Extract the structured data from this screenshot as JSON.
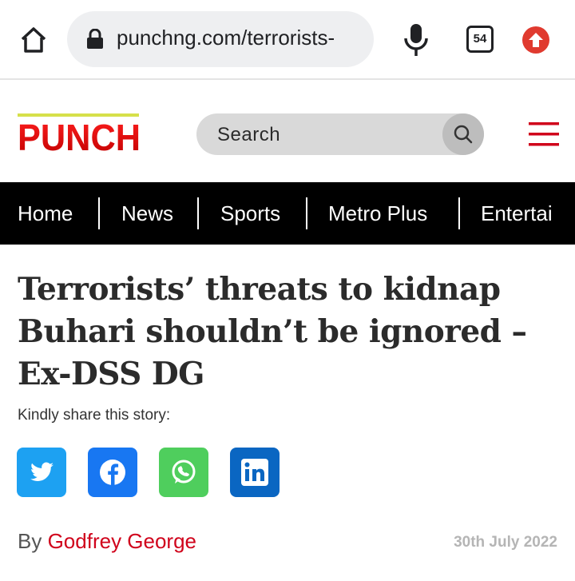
{
  "browser": {
    "url": "punchng.com/terrorists-",
    "tab_count": "54",
    "icons": [
      "home-icon",
      "lock-icon",
      "mic-icon",
      "tabs-icon",
      "update-icon"
    ]
  },
  "site": {
    "logo_text": "PUNCH",
    "search_placeholder": "Search",
    "brand_color": "#d0021b"
  },
  "nav": {
    "items": [
      "Home",
      "News",
      "Sports",
      "Metro Plus",
      "Entertai"
    ]
  },
  "article": {
    "headline_lines": [
      "Terrorists’ threats to kidnap",
      "Buhari shouldn’t be ignored –",
      "Ex-DSS DG"
    ],
    "share_label": "Kindly share this story:",
    "share_buttons": [
      {
        "name": "twitter",
        "color": "#1da1f2"
      },
      {
        "name": "facebook",
        "color": "#1877f2"
      },
      {
        "name": "whatsapp",
        "color": "#4fce5d"
      },
      {
        "name": "linkedin",
        "color": "#0a66c2"
      }
    ],
    "byline_prefix": "By ",
    "author": "Godfrey George",
    "date": "30th July 2022"
  }
}
